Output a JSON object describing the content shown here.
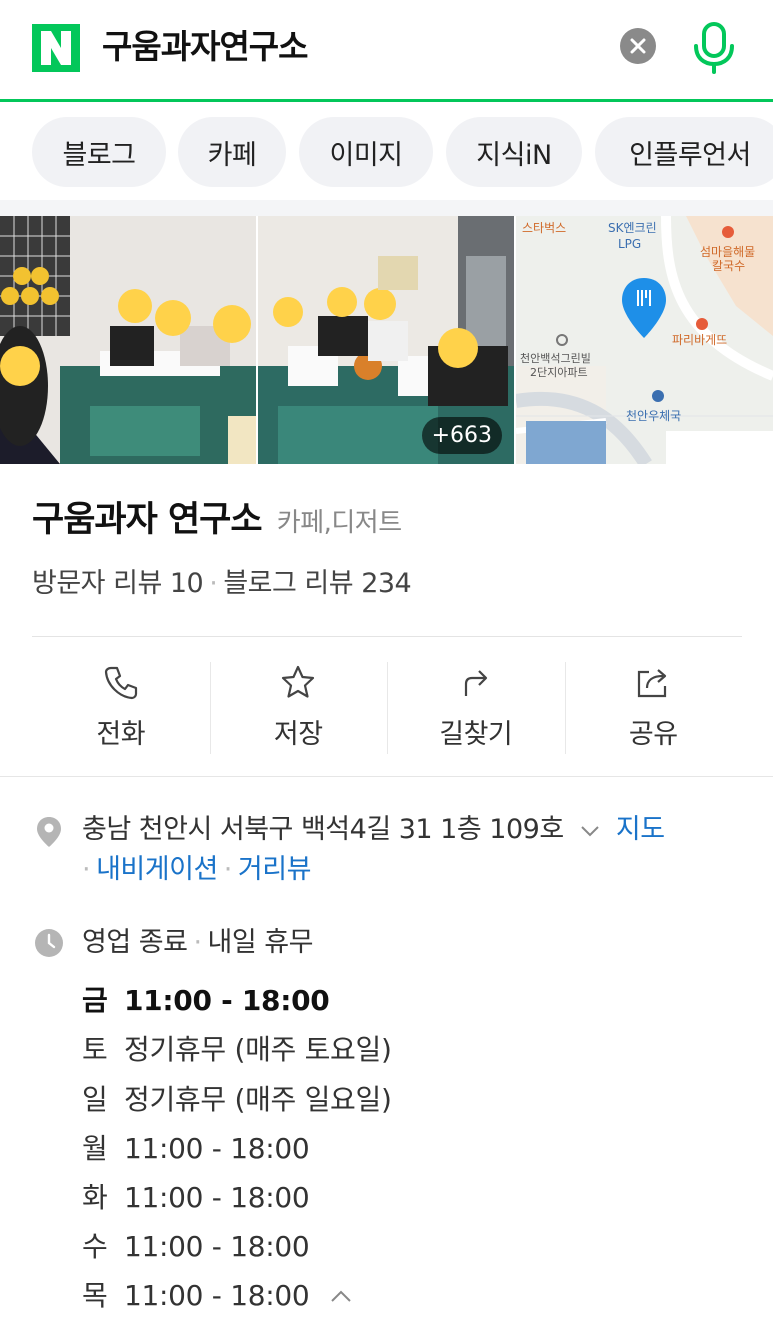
{
  "search": {
    "logo": "N",
    "query": "구움과자연구소"
  },
  "chips": [
    "블로그",
    "카페",
    "이미지",
    "지식iN",
    "인플루언서"
  ],
  "photos": {
    "count_label": "+663",
    "map_labels": [
      "스타벅스",
      "SK엔크린",
      "LPG",
      "섬마을해물",
      "칼국수",
      "파리바게뜨",
      "천안백석그린빌",
      "2단지아파트",
      "천안우체국"
    ]
  },
  "place": {
    "name": "구움과자 연구소",
    "category": "카페,디저트",
    "visitor_reviews": "방문자 리뷰 10",
    "blog_reviews": "블로그 리뷰 234"
  },
  "actions": [
    "전화",
    "저장",
    "길찾기",
    "공유"
  ],
  "address": {
    "text": "충남 천안시 서북구 백석4길 31 1층 109호",
    "map_link": "지도",
    "navigation_link": "내비게이션",
    "street_view_link": "거리뷰"
  },
  "hours": {
    "status": "영업 종료",
    "note": "내일 휴무",
    "rows": [
      {
        "day": "금",
        "time": "11:00 - 18:00"
      },
      {
        "day": "토",
        "time": "정기휴무 (매주 토요일)"
      },
      {
        "day": "일",
        "time": "정기휴무 (매주 일요일)"
      },
      {
        "day": "월",
        "time": "11:00 - 18:00"
      },
      {
        "day": "화",
        "time": "11:00 - 18:00"
      },
      {
        "day": "수",
        "time": "11:00 - 18:00"
      },
      {
        "day": "목",
        "time": "11:00 - 18:00"
      }
    ]
  },
  "colors": {
    "brand": "#03c75a",
    "link": "#1a73c9",
    "map_pin": "#1e8fe8"
  }
}
